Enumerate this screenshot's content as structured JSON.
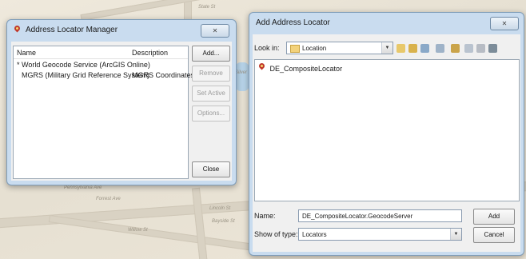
{
  "map": {
    "labels": [
      "Silver Lake",
      "Pennsylvania Ave",
      "Forrest Ave",
      "Lincoln St",
      "Bayside St",
      "Willow St",
      "State St"
    ]
  },
  "manager": {
    "title": "Address Locator Manager",
    "close_glyph": "✕",
    "columns": [
      "Name",
      "Description"
    ],
    "rows": [
      {
        "name": "* World Geocode Service (ArcGIS Online)",
        "description": ""
      },
      {
        "name": "MGRS (Military Grid Reference System)",
        "description": "MGRS Coordinates"
      }
    ],
    "buttons": {
      "add": "Add...",
      "remove": "Remove",
      "set_active": "Set Active",
      "options": "Options...",
      "close": "Close"
    }
  },
  "add_dialog": {
    "title": "Add Address Locator",
    "close_glyph": "✕",
    "look_in_label": "Look in:",
    "look_in_value": "Location",
    "items": [
      "DE_CompositeLocator"
    ],
    "name_label": "Name:",
    "name_value": "DE_CompositeLocator.GeocodeServer",
    "type_label": "Show of type:",
    "type_value": "Locators",
    "add_button": "Add",
    "cancel_button": "Cancel"
  },
  "colors": {
    "accent_selection": "#3399ff",
    "window_border": "#7f9db9"
  }
}
